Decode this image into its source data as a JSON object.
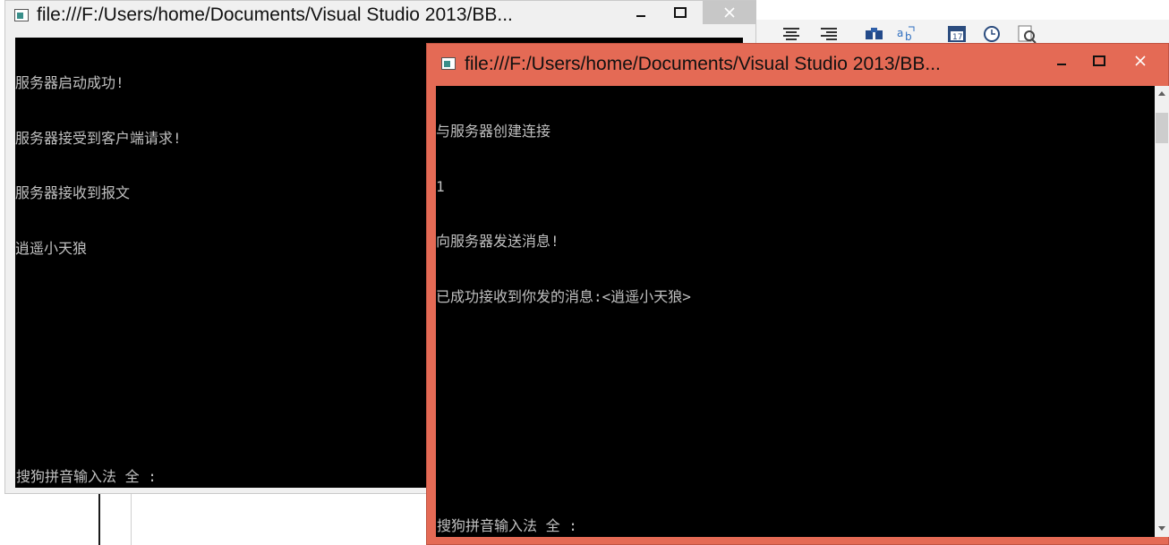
{
  "background_ide": {
    "toolbar_icons": [
      "align-center-icon",
      "align-right-icon",
      "find-icon",
      "replace-icon",
      "calendar-icon",
      "clock-icon",
      "zoom-icon"
    ]
  },
  "server_window": {
    "title": "file:///F:/Users/home/Documents/Visual Studio 2013/BB...",
    "lines": [
      "服务器启动成功!",
      "服务器接受到客户端请求!",
      "服务器接收到报文",
      "逍遥小天狼"
    ],
    "ime_status": "搜狗拼音输入法 全 :"
  },
  "client_window": {
    "title": "file:///F:/Users/home/Documents/Visual Studio 2013/BB...",
    "lines": [
      "与服务器创建连接",
      "1",
      "向服务器发送消息!",
      "已成功接收到你发的消息:<逍遥小天狼>"
    ],
    "ime_status": "搜狗拼音输入法 全 :",
    "active_border_color": "#e46a55"
  },
  "colors": {
    "console_bg": "#000000",
    "console_text": "#c0c0c0"
  }
}
